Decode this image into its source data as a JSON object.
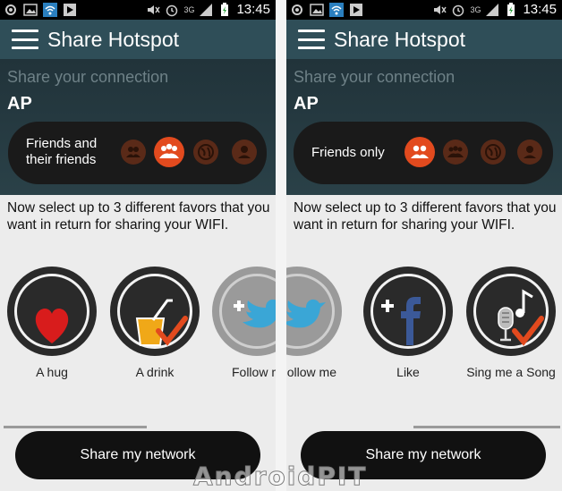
{
  "left": {
    "status_time": "13:45",
    "status_network": "3G",
    "header_title": "Share Hotspot",
    "subtitle": "Share your connection",
    "mode": "AP",
    "audience_label": "Friends and their friends",
    "audience_selected": 2,
    "instruction": "Now select up to 3 different favors that you want in return for sharing your WIFI.",
    "favors": [
      {
        "label": "A hug",
        "icon": "heart-icon",
        "checked": false
      },
      {
        "label": "A drink",
        "icon": "drink-icon",
        "checked": true
      },
      {
        "label": "Follow m",
        "icon": "twitter-bird-icon",
        "checked": false
      }
    ],
    "share_button": "Share my network"
  },
  "right": {
    "status_time": "13:45",
    "status_network": "3G",
    "header_title": "Share Hotspot",
    "subtitle": "Share your connection",
    "mode": "AP",
    "audience_label": "Friends only",
    "audience_selected": 1,
    "instruction": "Now select up to 3 different favors that you want in return for sharing your WIFI.",
    "favors": [
      {
        "label": "ollow me",
        "icon": "twitter-bird-icon",
        "checked": false
      },
      {
        "label": "Like",
        "icon": "facebook-icon",
        "checked": false
      },
      {
        "label": "Sing me a Song",
        "icon": "microphone-icon",
        "checked": true
      }
    ],
    "share_button": "Share my network"
  },
  "watermark": "AndroidPIT",
  "colors": {
    "header": "#2f4e58",
    "selected_option": "#e24a1e",
    "option": "#5a2a18",
    "check": "#e24a1e",
    "twitter": "#3aa6d6",
    "facebook": "#3b5998"
  }
}
